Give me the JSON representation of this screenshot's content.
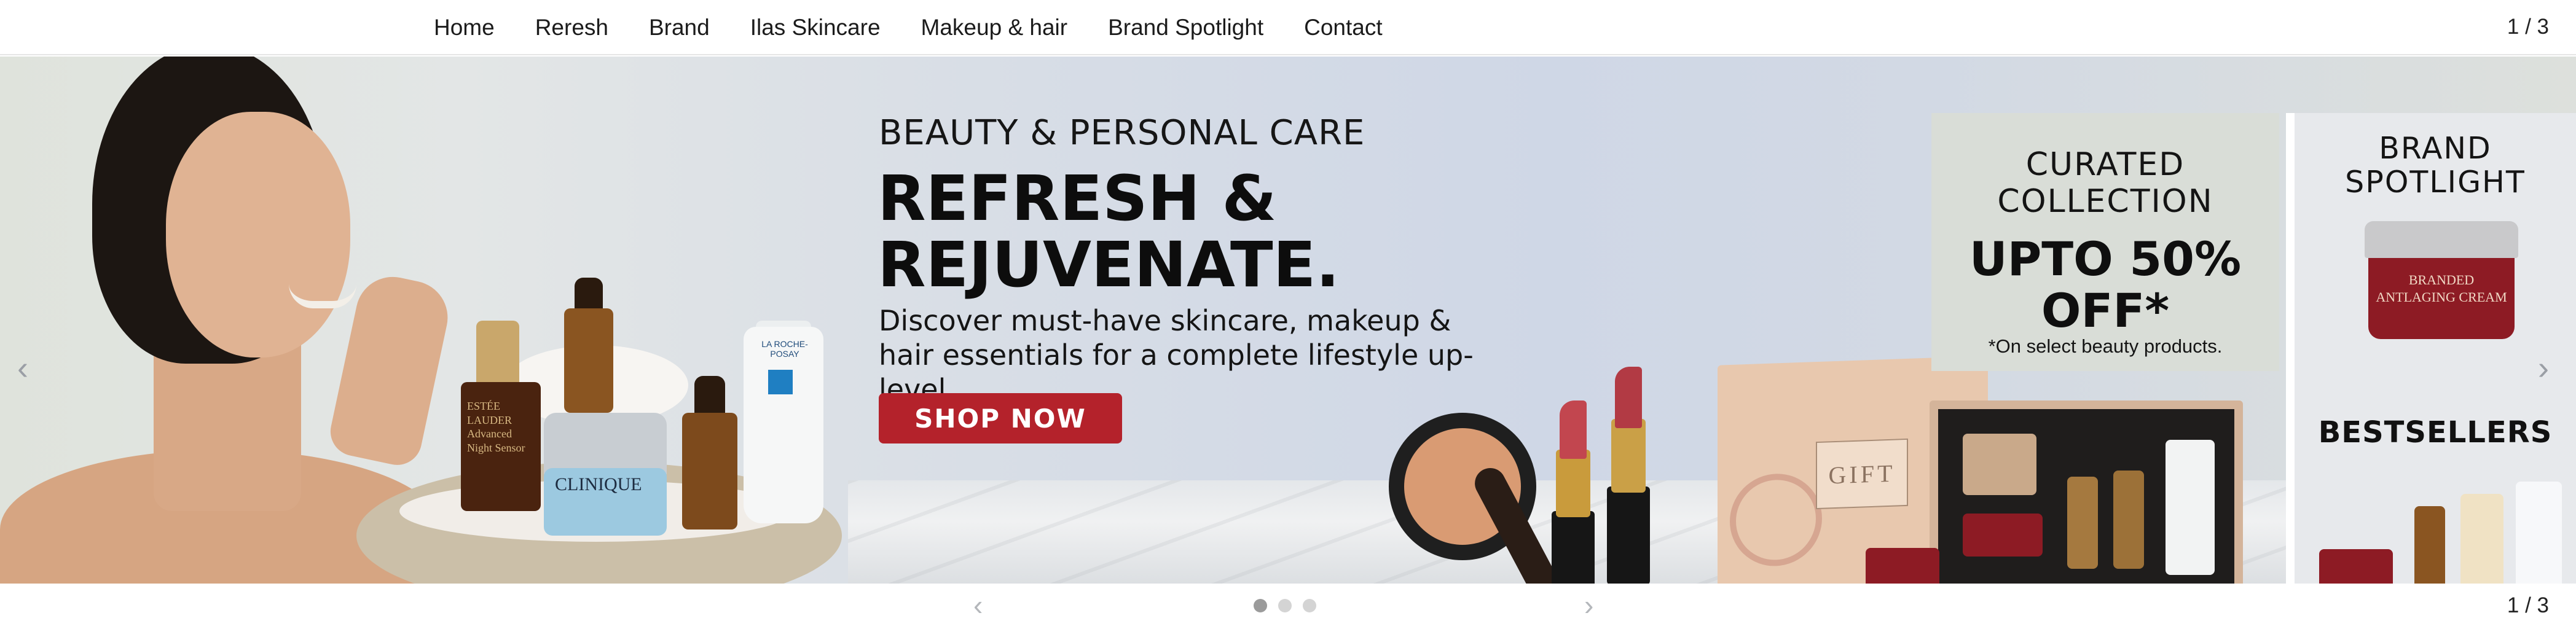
{
  "nav": {
    "items": [
      "Home",
      "Reresh",
      "Brand",
      "Ilas Skincare",
      "Makeup & hair",
      "Brand Spotlight",
      "Contact"
    ],
    "counter": "1 / 3"
  },
  "hero": {
    "eyebrow": "BEAUTY & PERSONAL CARE",
    "headline": "REFRESH & REJUVENATE.",
    "subtext": "Discover must-have skincare, makeup & hair essentials for a complete lifestyle up-level.",
    "cta": "SHOP NOW",
    "products": {
      "estee_label": "ESTÉE LAUDER Advanced Night Sensor",
      "clinique_label": "CLINIQUE",
      "laroche_label": "LA ROCHE-POSAY",
      "gift_label": "GIFT",
      "jar_label": "BRANDED ANTLAGING CREAM"
    }
  },
  "curated": {
    "title": "CURATED COLLECTION",
    "offer": "UPTO 50% OFF*",
    "note": "*On select beauty products."
  },
  "side": {
    "spotlight_title": "BRAND SPOTLIGHT",
    "bestsellers_title": "BESTSELLERS"
  },
  "carousel": {
    "counter": "1 / 3",
    "prev_icon": "chevron-left-icon",
    "next_icon": "chevron-right-icon",
    "slides": 3,
    "active_slide": 1
  },
  "colors": {
    "cta": "#b4222b",
    "jar": "#8d1b24"
  }
}
